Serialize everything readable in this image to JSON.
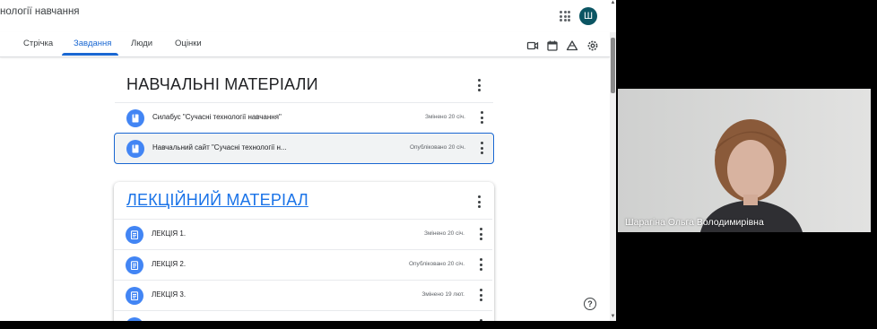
{
  "window": {
    "title": "нології навчання"
  },
  "header": {
    "avatar_letter": "Ш"
  },
  "tabs": [
    {
      "label": "Стрічка",
      "active": false
    },
    {
      "label": "Завдання",
      "active": true
    },
    {
      "label": "Люди",
      "active": false
    },
    {
      "label": "Оцінки",
      "active": false
    }
  ],
  "toolbar_icons": [
    "meet-icon",
    "calendar-icon",
    "drive-icon",
    "settings-icon"
  ],
  "section1": {
    "title": "НАВЧАЛЬНІ МАТЕРІАЛИ",
    "items": [
      {
        "title": "Силабус \"Сучасні технології навчання\"",
        "status": "Змінено 20 січ.",
        "icon": "material-icon",
        "selected": false
      },
      {
        "title": "Навчальний сайт \"Сучасні технології н...",
        "status": "Опубліковано 20 січ.",
        "icon": "material-icon",
        "selected": true
      }
    ]
  },
  "section2": {
    "title": "ЛЕКЦІЙНИЙ МАТЕРІАЛ",
    "items": [
      {
        "title": "ЛЕКЦІЯ 1.",
        "status": "Змінено 20 січ.",
        "icon": "assignment-icon"
      },
      {
        "title": "ЛЕКЦІЯ 2.",
        "status": "Опубліковано 20 січ.",
        "icon": "assignment-icon"
      },
      {
        "title": "ЛЕКЦІЯ 3.",
        "status": "Змінено 19 лют.",
        "icon": "assignment-icon"
      }
    ]
  },
  "video": {
    "participant_name": "Шарагіна Ольга Володимирівна"
  },
  "colors": {
    "accent": "#1967d2",
    "icon_bg": "#4285f4",
    "avatar_bg": "#0b5563"
  }
}
